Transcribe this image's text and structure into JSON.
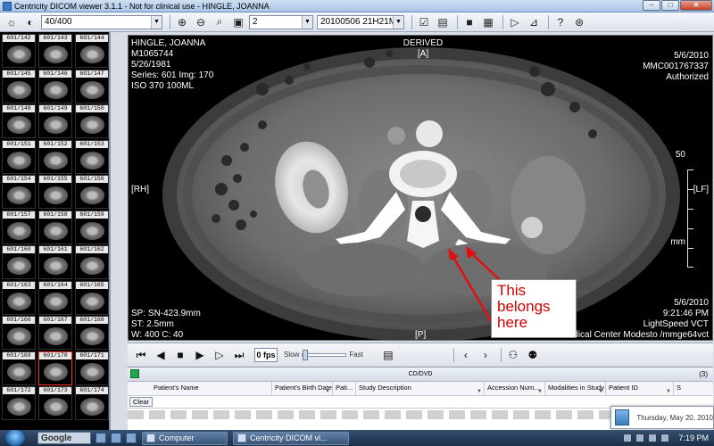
{
  "window": {
    "title": "Centricity DICOM viewer 3.1.1 - Not for clinical use - HINGLE, JOANNA"
  },
  "toolbar": {
    "image_counter": "40/400",
    "layout_value": "2",
    "series_select": "20100506 21H21M"
  },
  "thumbnails": [
    "601/142",
    "601/143",
    "601/144",
    "601/145",
    "601/146",
    "601/147",
    "601/148",
    "601/149",
    "601/150",
    "601/151",
    "601/152",
    "601/153",
    "601/154",
    "601/155",
    "601/156",
    "601/157",
    "601/158",
    "601/159",
    "601/160",
    "601/161",
    "601/162",
    "601/163",
    "601/164",
    "601/165",
    "601/166",
    "601/167",
    "601/168",
    "601/169",
    "601/170",
    "601/171",
    "601/172",
    "601/173",
    "601/174"
  ],
  "selected_thumbnail": "601/170",
  "overlay": {
    "patient_name": "HINGLE, JOANNA",
    "patient_id": "M1065744",
    "birth_date": "5/26/1981",
    "series_img": "Series: 601 Img: 170",
    "contrast": "ISO 370 100ML",
    "top_center": "DERIVED",
    "orient_top": "[A]",
    "orient_left": "[RH]",
    "orient_right": "[LF]",
    "orient_bottom": "[P]",
    "study_date": "5/6/2010",
    "accession": "MMC001767337",
    "status": "Authorized",
    "slice_pos": "SP: SN-423.9mm",
    "slice_thickness": "ST:   2.5mm",
    "window_level": "W: 400 C: 40",
    "br_date": "5/6/2010",
    "br_time": "9:21:46 PM",
    "br_scanner": "LightSpeed VCT",
    "br_institution": "dical Center Modesto /mmge64vct",
    "scale_label": "50",
    "scale_unit": "mm"
  },
  "annotation": {
    "text_line1": "This",
    "text_line2": "belongs",
    "text_line3": "here"
  },
  "cine": {
    "fps": "0 fps",
    "slow_label": "Slow",
    "fast_label": "Fast"
  },
  "studylist": {
    "group_title": "CD/DVD",
    "count": "(3)",
    "clear_label": "Clear",
    "columns": [
      "Patient's Name",
      "Patient's Birth Date",
      "Pati...",
      "Study Description",
      "Accession Num...",
      "Modalities in Study",
      "Patient ID",
      "S"
    ]
  },
  "datepopup": {
    "text": "Thursday, May 20, 2010"
  },
  "taskbar": {
    "search_label": "Google",
    "task1": "Computer",
    "task2": "Centricity DICOM vi...",
    "clock": "7:19 PM"
  }
}
